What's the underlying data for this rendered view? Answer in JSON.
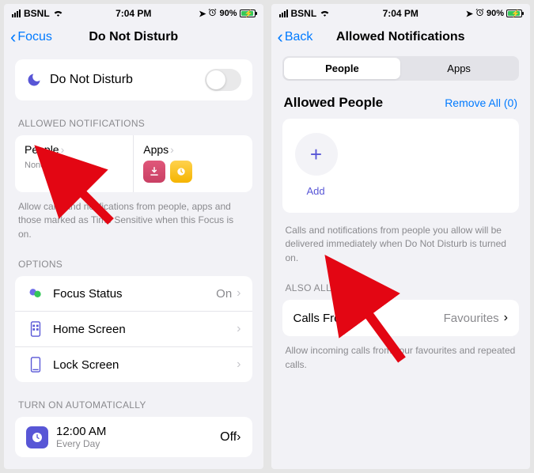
{
  "status": {
    "carrier": "BSNL",
    "time": "7:04 PM",
    "battery_pct": "90%"
  },
  "left": {
    "back": "Focus",
    "title": "Do Not Disturb",
    "dnd_label": "Do Not Disturb",
    "allowed_header": "ALLOWED NOTIFICATIONS",
    "people_label": "People",
    "people_sub": "None allowed",
    "apps_label": "Apps",
    "allowed_footer": "Allow calls and notifications from people, apps and those marked as Time Sensitive when this Focus is on.",
    "options_header": "OPTIONS",
    "rows": {
      "focus_status": {
        "label": "Focus Status",
        "value": "On"
      },
      "home_screen": {
        "label": "Home Screen"
      },
      "lock_screen": {
        "label": "Lock Screen"
      }
    },
    "auto_header": "TURN ON AUTOMATICALLY",
    "schedule": {
      "time": "12:00 AM",
      "repeat": "Every Day",
      "state": "Off"
    }
  },
  "right": {
    "back": "Back",
    "title": "Allowed Notifications",
    "seg_people": "People",
    "seg_apps": "Apps",
    "allowed_people": "Allowed People",
    "remove_all": "Remove All (0)",
    "add": "Add",
    "add_footer": "Calls and notifications from people you allow will be delivered immediately when Do Not Disturb is turned on.",
    "also_allow": "ALSO ALLOW",
    "calls_from": "Calls From",
    "calls_from_value": "Favourites",
    "calls_footer": "Allow incoming calls from your favourites and repeated calls."
  }
}
